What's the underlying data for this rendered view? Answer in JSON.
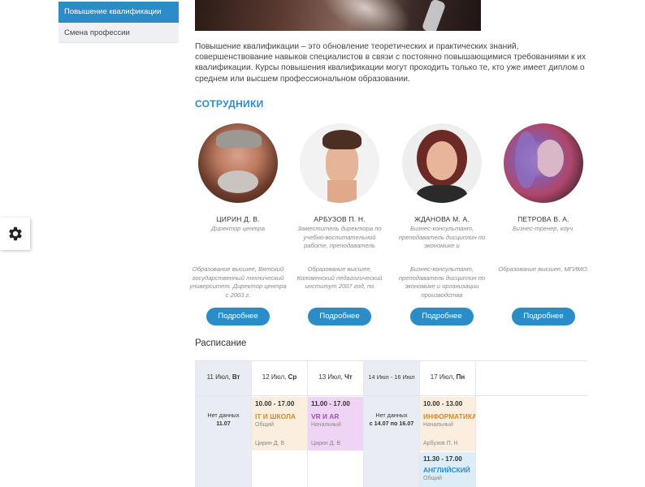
{
  "sidebar": {
    "items": [
      {
        "label": "Повышение квалификации"
      },
      {
        "label": "Смена профессии"
      }
    ]
  },
  "intro": "Повышение квалификации – это обновление теоретических и практических знаний, совершенствование навыков специалистов в связи с постоянно повышающимися требованиями к их квалификации. Курсы повышения квалификации могут проходить только те, кто уже имеет диплом о среднем или высшем профессиональном образовании.",
  "staff": {
    "title": "СОТРУДНИКИ",
    "button_label": "Подробнее",
    "people": [
      {
        "name": "ЦИРИН Д. В.",
        "role": "Директор центра",
        "edu": "Образование высшее, Вятский государственный технический университет. Директор центра с 2003 г."
      },
      {
        "name": "АРБУЗОВ П. Н.",
        "role": "Заместитель директора по учебно-воспитательной работе, преподаватель",
        "edu": "Образование высшее, Коломенский педагогический институт 2007 год, по"
      },
      {
        "name": "ЖДАНОВА М. А.",
        "role": "Бизнес-консультант, преподаватель дисциплин по экономике и",
        "edu": "Бизнес-консультант, преподаватель дисциплин по экономике и организации производства"
      },
      {
        "name": "ПЕТРОВА В. А.",
        "role": "Бизнес-тренер, коуч.",
        "edu": "Образование высшее, МГИМО."
      }
    ]
  },
  "schedule": {
    "title": "Расписание",
    "columns": [
      {
        "date": "11 Июл,",
        "day": "Вт",
        "nodata": "Нет данных",
        "nodata_range": "11.07"
      },
      {
        "date": "12 Июл,",
        "day": "Ср"
      },
      {
        "date": "13 Июл,",
        "day": "Чт"
      },
      {
        "date": "14 Июл - 16 Июл",
        "day": "",
        "nodata": "Нет данных",
        "nodata_range": "с 14.07 по 16.07"
      },
      {
        "date": "17 Июл,",
        "day": "Пн"
      }
    ],
    "events": [
      {
        "time": "10.00 - 17.00",
        "name": "IT И ШКОЛА",
        "level": "Общий",
        "teacher": "Цирин Д. В",
        "color": "#d18a2b",
        "bg": "#fbeede"
      },
      {
        "time": "11.00 - 17.00",
        "name": "VR И AR",
        "level": "Начальный",
        "teacher": "Цирин Д. В",
        "color": "#a14fb8",
        "bg": "#efd4f5"
      },
      {
        "time": "10.00 - 13.00",
        "name": "ИНФОРМАТИКА",
        "level": "Начальный",
        "teacher": "Арбузов П. Н",
        "color": "#d18a2b",
        "bg": "#fbeede"
      },
      {
        "time": "11.30 - 17.00",
        "name": "АНГЛИЙСКИЙ",
        "level": "Общий",
        "teacher": "",
        "color": "#2b8cc8",
        "bg": "#dcedf8"
      }
    ]
  },
  "colors": {
    "accent": "#2b8cc8"
  }
}
